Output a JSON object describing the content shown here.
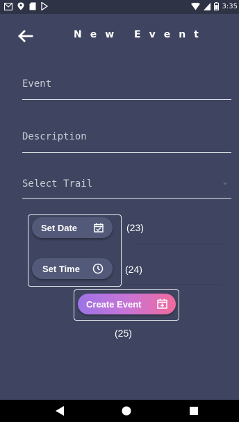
{
  "status_bar": {
    "time": "3:35",
    "icons": [
      "gmail-icon",
      "location-icon",
      "sd-card-icon",
      "play-store-icon",
      "wifi-icon",
      "signal-icon",
      "battery-icon"
    ]
  },
  "app_bar": {
    "title": "New Event",
    "back_icon": "arrow-left-icon"
  },
  "form": {
    "event_label": "Event",
    "description_label": "Description",
    "trail_label": "Select Trail"
  },
  "buttons": {
    "set_date": "Set Date",
    "set_time": "Set Time",
    "create_event": "Create Event"
  },
  "annotations": {
    "a23": "(23)",
    "a24": "(24)",
    "a25": "(25)"
  },
  "colors": {
    "background": "#3f4560",
    "status_bar": "#2e3346",
    "pill": "#535a79",
    "gradient_start": "#9d73e6",
    "gradient_end": "#ef6a9c"
  }
}
